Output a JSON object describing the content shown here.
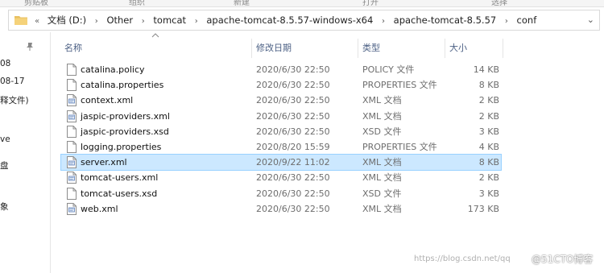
{
  "topstrip": {
    "items": [
      "剪贴板",
      "组织",
      "新建",
      "打开",
      "选择"
    ]
  },
  "address": {
    "overflow": "«",
    "crumbs": [
      "文档 (D:)",
      "Other",
      "tomcat",
      "apache-tomcat-8.5.57-windows-x64",
      "apache-tomcat-8.5.57",
      "conf"
    ],
    "separator": "›",
    "dropdown": "⌄"
  },
  "nav": {
    "fragments": [
      "08",
      "08-17",
      "释文件)",
      "ve",
      "盘",
      "象"
    ]
  },
  "columns": {
    "name": "名称",
    "date": "修改日期",
    "type": "类型",
    "size": "大小"
  },
  "files": [
    {
      "name": "catalina.policy",
      "date": "2020/6/30 22:50",
      "type": "POLICY 文件",
      "size": "14 KB",
      "icon": "generic-file-icon"
    },
    {
      "name": "catalina.properties",
      "date": "2020/6/30 22:50",
      "type": "PROPERTIES 文件",
      "size": "8 KB",
      "icon": "generic-file-icon"
    },
    {
      "name": "context.xml",
      "date": "2020/6/30 22:50",
      "type": "XML 文档",
      "size": "2 KB",
      "icon": "xml-file-icon"
    },
    {
      "name": "jaspic-providers.xml",
      "date": "2020/6/30 22:50",
      "type": "XML 文档",
      "size": "2 KB",
      "icon": "xml-file-icon"
    },
    {
      "name": "jaspic-providers.xsd",
      "date": "2020/6/30 22:50",
      "type": "XSD 文件",
      "size": "3 KB",
      "icon": "generic-file-icon"
    },
    {
      "name": "logging.properties",
      "date": "2020/8/20 15:59",
      "type": "PROPERTIES 文件",
      "size": "4 KB",
      "icon": "generic-file-icon"
    },
    {
      "name": "server.xml",
      "date": "2020/9/22 11:02",
      "type": "XML 文档",
      "size": "8 KB",
      "icon": "xml-file-icon",
      "selected": true
    },
    {
      "name": "tomcat-users.xml",
      "date": "2020/6/30 22:50",
      "type": "XML 文档",
      "size": "2 KB",
      "icon": "xml-file-icon"
    },
    {
      "name": "tomcat-users.xsd",
      "date": "2020/6/30 22:50",
      "type": "XSD 文件",
      "size": "3 KB",
      "icon": "generic-file-icon"
    },
    {
      "name": "web.xml",
      "date": "2020/6/30 22:50",
      "type": "XML 文档",
      "size": "173 KB",
      "icon": "xml-file-icon"
    }
  ],
  "watermark": {
    "url": "https://blog.csdn.net/qq",
    "brand": "@51CTO博客"
  },
  "colors": {
    "selection": "#cce8ff",
    "header_text": "#4d6185",
    "folder": "#e8c060"
  }
}
